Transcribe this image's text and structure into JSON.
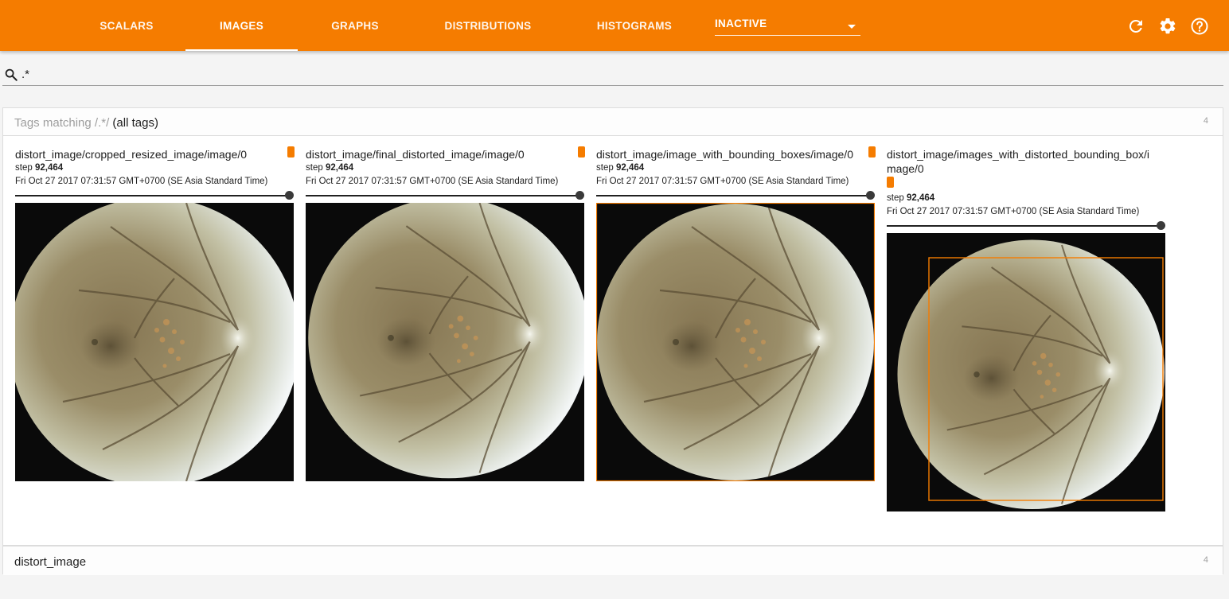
{
  "tabs": [
    {
      "label": "SCALARS",
      "active": false
    },
    {
      "label": "IMAGES",
      "active": true
    },
    {
      "label": "GRAPHS",
      "active": false
    },
    {
      "label": "DISTRIBUTIONS",
      "active": false
    },
    {
      "label": "HISTOGRAMS",
      "active": false
    }
  ],
  "inactive_dropdown": {
    "selected": "INACTIVE"
  },
  "toolbar_icons": [
    "refresh-icon",
    "settings-icon",
    "help-icon"
  ],
  "search": {
    "value": ".*"
  },
  "tag_pane": {
    "prefix": "Tags matching /",
    "pattern": ".*",
    "suffix": "/",
    "note": "(all tags)",
    "count": "4"
  },
  "cards": [
    {
      "tag": "distort_image/cropped_resized_image/image/0",
      "step_label": "step",
      "step": "92,464",
      "timestamp": "Fri Oct 27 2017 07:31:57 GMT+0700 (SE Asia Standard Time)"
    },
    {
      "tag": "distort_image/final_distorted_image/image/0",
      "step_label": "step",
      "step": "92,464",
      "timestamp": "Fri Oct 27 2017 07:31:57 GMT+0700 (SE Asia Standard Time)"
    },
    {
      "tag": "distort_image/image_with_bounding_boxes/image/0",
      "step_label": "step",
      "step": "92,464",
      "timestamp": "Fri Oct 27 2017 07:31:57 GMT+0700 (SE Asia Standard Time)"
    },
    {
      "tag": "distort_image/images_with_distorted_bounding_box/image/0",
      "step_label": "step",
      "step": "92,464",
      "timestamp": "Fri Oct 27 2017 07:31:57 GMT+0700 (SE Asia Standard Time)"
    }
  ],
  "group_pane": {
    "title": "distort_image",
    "count": "4"
  },
  "colors": {
    "accent": "#f57c00",
    "text": "#212121",
    "muted": "#9e9e9e"
  }
}
